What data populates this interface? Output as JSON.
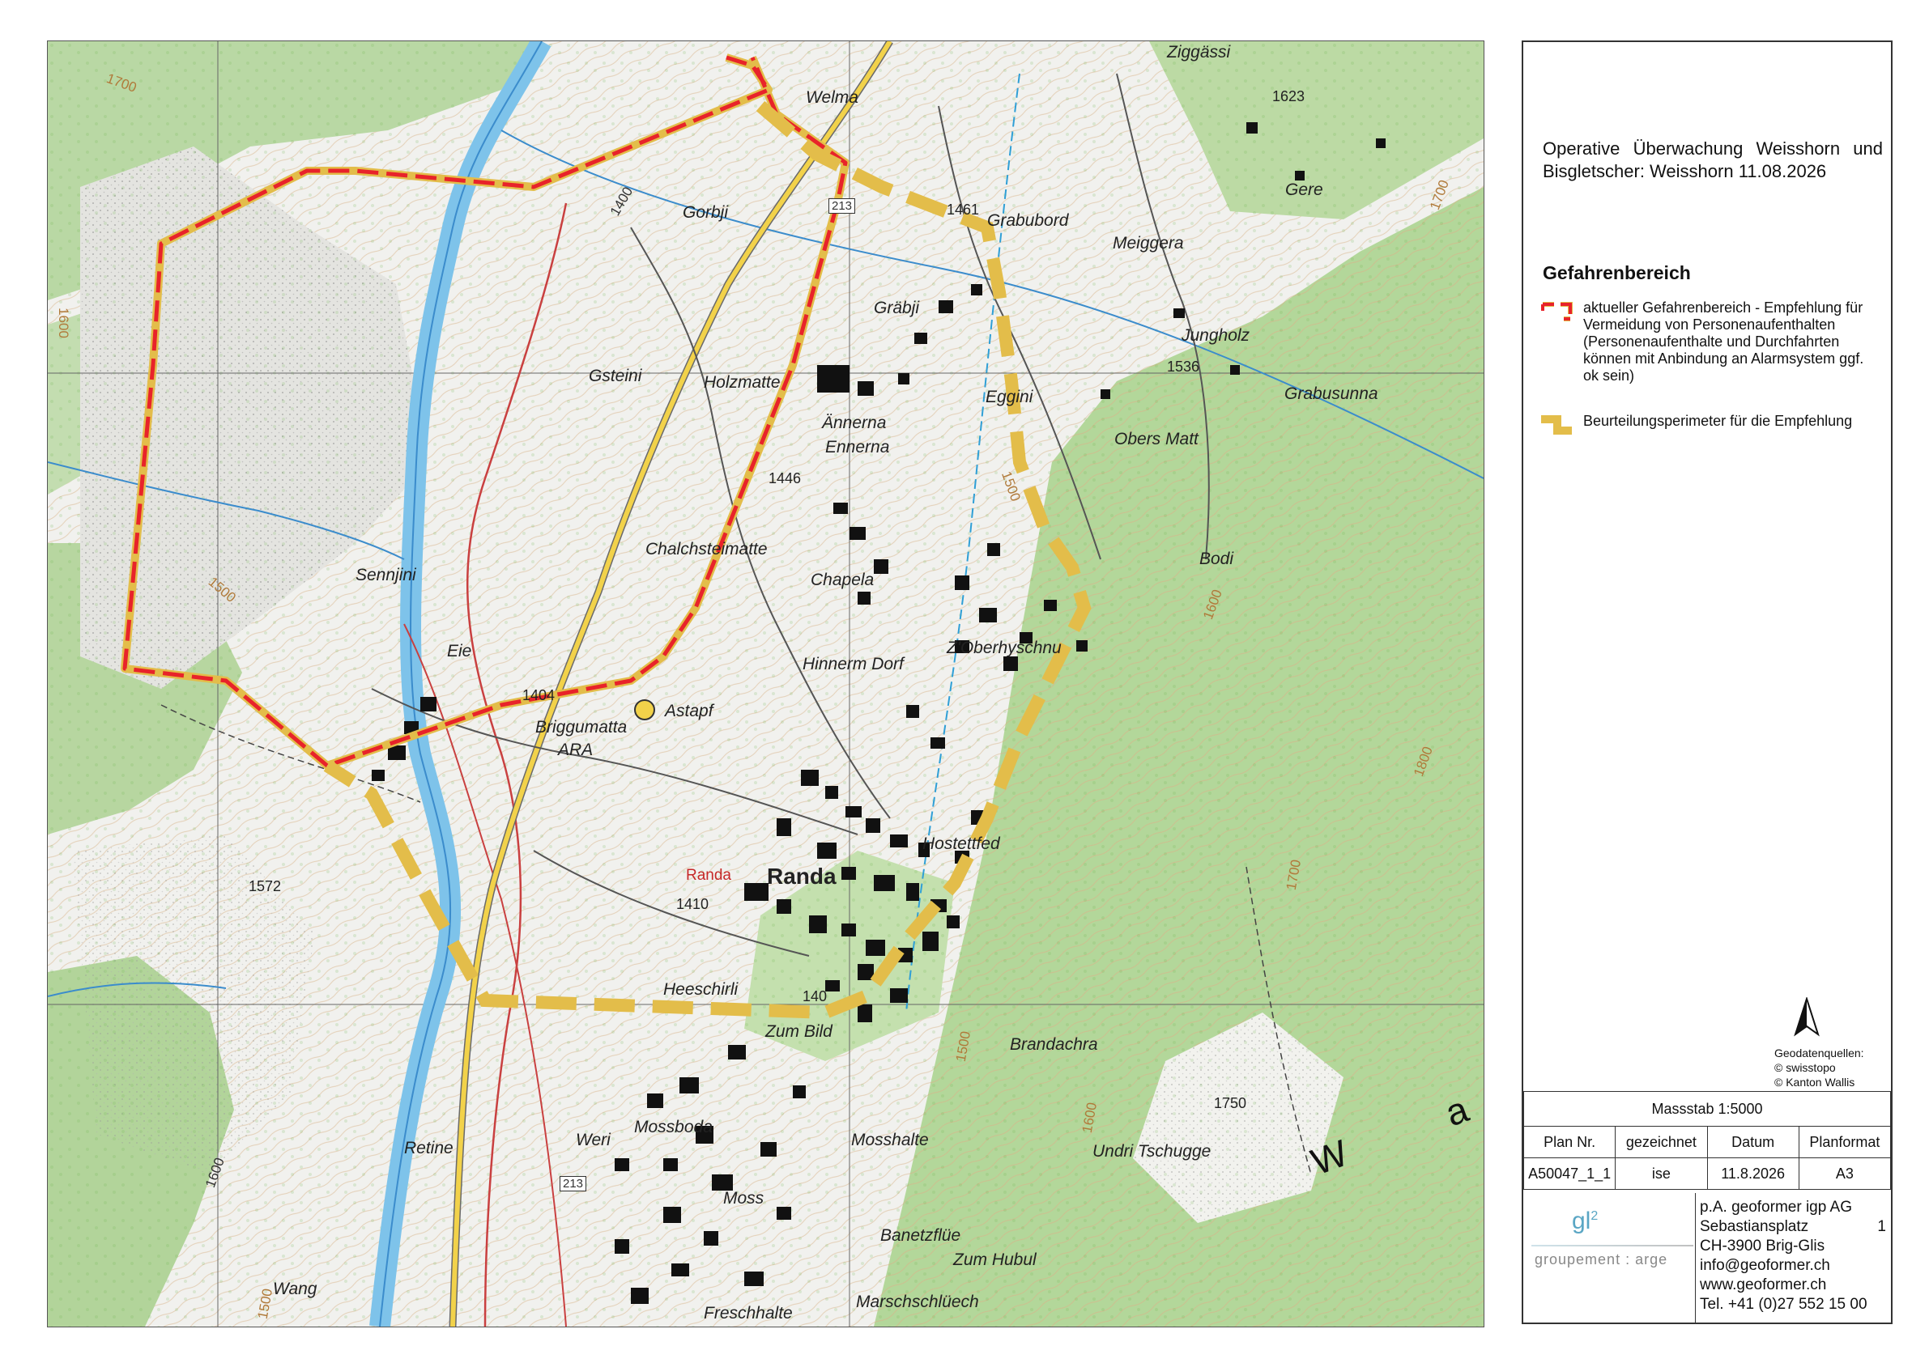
{
  "map": {
    "places": [
      {
        "key": "ziggassi",
        "label": "Ziggässi"
      },
      {
        "key": "welma",
        "label": "Welma"
      },
      {
        "key": "gorbji",
        "label": "Gorbji"
      },
      {
        "key": "grabubord",
        "label": "Grabubord"
      },
      {
        "key": "meiggera",
        "label": "Meiggera"
      },
      {
        "key": "gere",
        "label": "Gere"
      },
      {
        "key": "grabji",
        "label": "Gräbji"
      },
      {
        "key": "jungholz",
        "label": "Jungholz"
      },
      {
        "key": "gsteini",
        "label": "Gsteini"
      },
      {
        "key": "holzmatte",
        "label": "Holzmatte"
      },
      {
        "key": "eggini",
        "label": "Eggini"
      },
      {
        "key": "grabusunna",
        "label": "Grabusunna"
      },
      {
        "key": "annerna",
        "label": "Ännerna"
      },
      {
        "key": "ennerna",
        "label": "Ennerna"
      },
      {
        "key": "obers_matt",
        "label": "Obers Matt"
      },
      {
        "key": "chalchsteimatte",
        "label": "Chalchsteimatte"
      },
      {
        "key": "chapela",
        "label": "Chapela"
      },
      {
        "key": "bodi",
        "label": "Bodi"
      },
      {
        "key": "sennjini",
        "label": "Sennjini"
      },
      {
        "key": "eie",
        "label": "Eie"
      },
      {
        "key": "zoberhyschnu",
        "label": "Z'Oberhyschnu"
      },
      {
        "key": "hinnerm_dorf",
        "label": "Hinnerm Dorf"
      },
      {
        "key": "astapf",
        "label": "Astapf"
      },
      {
        "key": "briggumatta",
        "label": "Briggumatta"
      },
      {
        "key": "ara",
        "label": "ARA"
      },
      {
        "key": "hostettfed",
        "label": "Hostettfed"
      },
      {
        "key": "randa_station",
        "label": "Randa"
      },
      {
        "key": "randa",
        "label": "Randa"
      },
      {
        "key": "heeschirli",
        "label": "Heeschirli"
      },
      {
        "key": "zum_bild",
        "label": "Zum Bild"
      },
      {
        "key": "brandachra",
        "label": "Brandachra"
      },
      {
        "key": "retine",
        "label": "Retine"
      },
      {
        "key": "weri",
        "label": "Weri"
      },
      {
        "key": "mossboda",
        "label": "Mossboda"
      },
      {
        "key": "mosshalte",
        "label": "Mosshalte"
      },
      {
        "key": "undri_tschugge",
        "label": "Undri Tschugge"
      },
      {
        "key": "moss",
        "label": "Moss"
      },
      {
        "key": "banetzflue",
        "label": "Banetzflüe"
      },
      {
        "key": "zum_hubul",
        "label": "Zum Hubul"
      },
      {
        "key": "wang",
        "label": "Wang"
      },
      {
        "key": "marschschluech",
        "label": "Marschschlüech"
      },
      {
        "key": "freschhalte",
        "label": "Freschhalte"
      }
    ],
    "elevations": [
      {
        "key": "e1623",
        "label": "1623"
      },
      {
        "key": "e1461",
        "label": "1461"
      },
      {
        "key": "e1536",
        "label": "1536"
      },
      {
        "key": "e1446",
        "label": "1446"
      },
      {
        "key": "e1404",
        "label": "1404"
      },
      {
        "key": "e1572",
        "label": "1572"
      },
      {
        "key": "e1410",
        "label": "1410"
      },
      {
        "key": "e140",
        "label": "140"
      },
      {
        "key": "e1750",
        "label": "1750"
      }
    ],
    "contours": [
      {
        "key": "c1700a",
        "label": "1700"
      },
      {
        "key": "c1700b",
        "label": "1700"
      },
      {
        "key": "c1400",
        "label": "1400"
      },
      {
        "key": "c1600a",
        "label": "1600"
      },
      {
        "key": "c1500a",
        "label": "1500"
      },
      {
        "key": "c1500b",
        "label": "1500"
      },
      {
        "key": "c1600b",
        "label": "1600"
      },
      {
        "key": "c1800",
        "label": "1800"
      },
      {
        "key": "c1700c",
        "label": "1700"
      },
      {
        "key": "c1500c",
        "label": "1500"
      },
      {
        "key": "c1600c",
        "label": "1600"
      },
      {
        "key": "c1600d",
        "label": "1600"
      },
      {
        "key": "c1500d",
        "label": "1500"
      }
    ],
    "road_numbers": [
      {
        "key": "r213a",
        "label": "213"
      },
      {
        "key": "r213b",
        "label": "213"
      }
    ],
    "region_label": "W a l",
    "colors": {
      "hazard_red": "#e8232a",
      "perimeter_yellow": "#e3bd4a",
      "river": "#7ec3ea",
      "forest": "#b5d99a"
    }
  },
  "panel": {
    "title": "Operative Überwachung Weisshorn und Bisgletscher: Weisshorn 11.08.2026",
    "hazard_heading": "Gefahrenbereich",
    "legend": [
      {
        "symbol": "red-dashed-outline",
        "text": "aktueller Gefahrenbereich - Empfehlung für Vermeidung von Personenaufenthalten (Personenaufenthalte und Durchfahrten können mit Anbindung an Alarmsystem ggf. ok sein)"
      },
      {
        "symbol": "yellow-dashed-outline",
        "text": "Beurteilungsperimeter für die Empfehlung"
      }
    ],
    "north_arrow": "north-arrow-icon",
    "sources": {
      "heading": "Geodatenquellen:",
      "lines": [
        "© swisstopo",
        "© Kanton Wallis"
      ]
    },
    "scale": "Massstab 1:5000",
    "table": {
      "headers": [
        "Plan Nr.",
        "gezeichnet",
        "Datum",
        "Planformat"
      ],
      "values": [
        "A50047_1_1",
        "ise",
        "11.8.2026",
        "A3"
      ]
    },
    "logo": {
      "main": "gl",
      "sup": "2",
      "sub": "groupement : arge"
    },
    "address": {
      "company": "p.A. geoformer igp AG",
      "street": "Sebastiansplatz",
      "street_no": "1",
      "city": "CH-3900 Brig-Glis",
      "email": "info@geoformer.ch",
      "web": "www.geoformer.ch",
      "phone": "Tel. +41 (0)27 552 15 00"
    }
  }
}
